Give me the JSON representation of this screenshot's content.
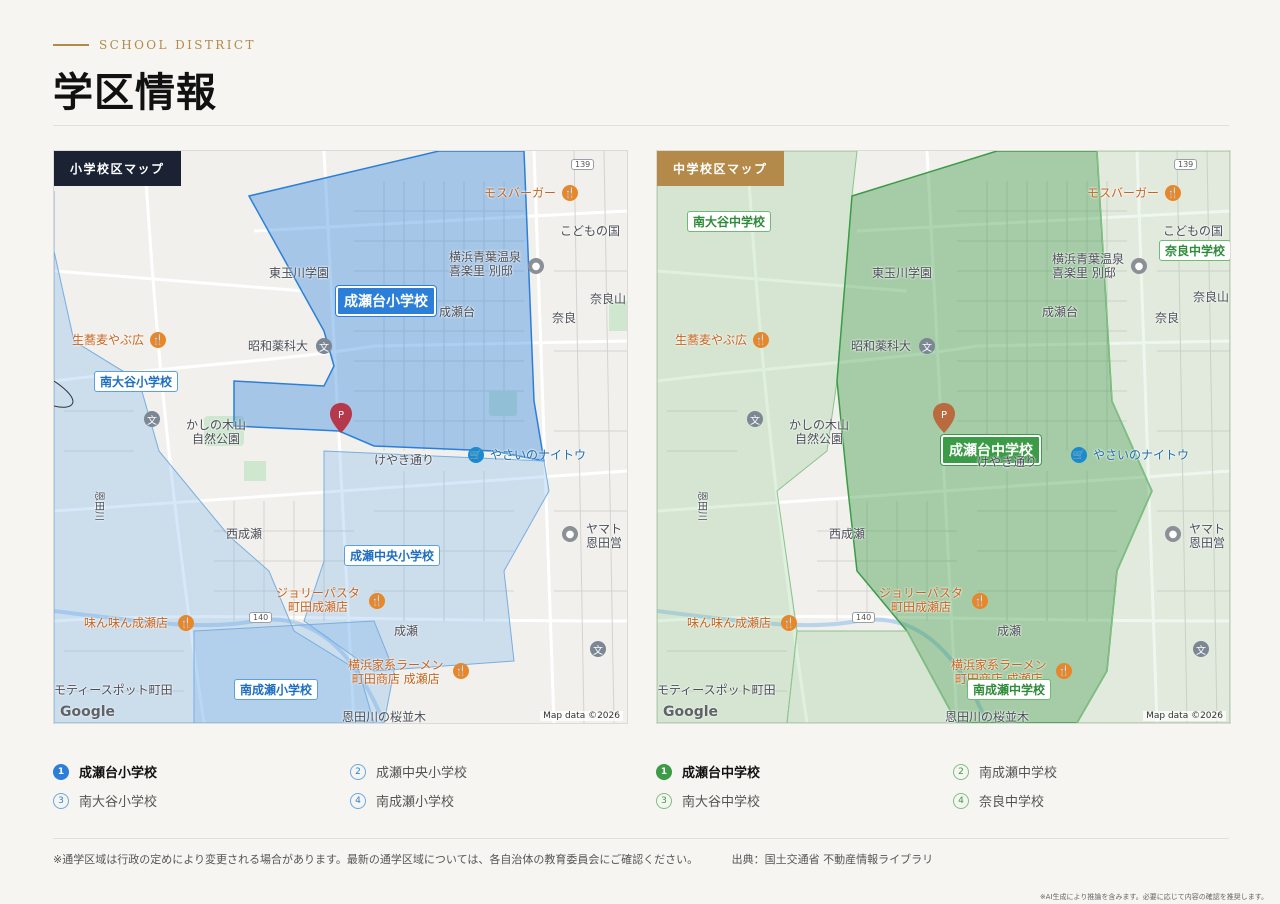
{
  "header": {
    "eyebrow": "SCHOOL DISTRICT",
    "title": "学区情報"
  },
  "maps": {
    "elementary": {
      "tag": "小学校区マップ",
      "labels": {
        "higashi_tamagawa": "東玉川学園",
        "showa_yakka": "昭和薬科大",
        "naruseidai": "成瀬台",
        "nara": "奈良",
        "kashi_park": "かしの木山\n自然公園",
        "keyaki": "けやき通り",
        "nishinaruse": "西成瀬",
        "naruse": "成瀬",
        "yokohama_aoba": "横浜青葉温泉\n喜楽里 別邸",
        "kodomo": "こどもの国",
        "narayama": "奈良山",
        "yamato": "ヤマト\n恩田営",
        "onda_river": "恩田川の桜並木",
        "motyspot": "モティースポット町田",
        "onda": "恩田川"
      },
      "pois": {
        "mos": "モスバーガー",
        "soba": "生蕎麦やぶ広",
        "jolly": "ジョリーパスタ\n町田成瀬店",
        "miun": "味ん味ん成瀬店",
        "ramen": "横浜家系ラーメン\n町田商店 成瀬店",
        "yasai": "やさいのナイトウ"
      },
      "schools": {
        "main": "成瀬台小学校",
        "minamioya": "南大谷小学校",
        "chuo": "成瀬中央小学校",
        "minaminaruse": "南成瀬小学校"
      },
      "roads": {
        "r139": "139",
        "r140": "140"
      },
      "google": "Google",
      "copyright": "Map data ©2026"
    },
    "middle": {
      "tag": "中学校区マップ",
      "labels": {
        "higashi_tamagawa": "東玉川学園",
        "showa_yakka": "昭和薬科大",
        "naruseidai": "成瀬台",
        "nara": "奈良",
        "kashi_park": "かしの木山\n自然公園",
        "keyaki": "けやき通り",
        "nishinaruse": "西成瀬",
        "naruse": "成瀬",
        "yokohama_aoba": "横浜青葉温泉\n喜楽里 別邸",
        "kodomo": "こどもの国",
        "narayama": "奈良山",
        "yamato": "ヤマト\n恩田営",
        "onda_river": "恩田川の桜並木",
        "motyspot": "モティースポット町田",
        "onda": "恩田川"
      },
      "pois": {
        "mos": "モスバーガー",
        "soba": "生蕎麦やぶ広",
        "jolly": "ジョリーパスタ\n町田成瀬店",
        "miun": "味ん味ん成瀬店",
        "ramen": "横浜家系ラーメン\n町田商店 成瀬店",
        "yasai": "やさいのナイトウ"
      },
      "schools": {
        "main": "成瀬台中学校",
        "minamioya": "南大谷中学校",
        "nara": "奈良中学校",
        "minaminaruse": "南成瀬中学校"
      },
      "roads": {
        "r139": "139",
        "r140": "140"
      },
      "google": "Google",
      "copyright": "Map data ©2026"
    }
  },
  "lists": {
    "elementary": [
      {
        "n": "1",
        "name": "成瀬台小学校"
      },
      {
        "n": "2",
        "name": "成瀬中央小学校"
      },
      {
        "n": "3",
        "name": "南大谷小学校"
      },
      {
        "n": "4",
        "name": "南成瀬小学校"
      }
    ],
    "middle": [
      {
        "n": "1",
        "name": "成瀬台中学校"
      },
      {
        "n": "2",
        "name": "南成瀬中学校"
      },
      {
        "n": "3",
        "name": "南大谷中学校"
      },
      {
        "n": "4",
        "name": "奈良中学校"
      }
    ]
  },
  "footer": {
    "note": "※通学区域は行政の定めにより変更される場合があります。最新の通学区域については、各自治体の教育委員会にご確認ください。",
    "source": "出典：国土交通省 不動産情報ライブラリ",
    "ai": "※AI生成により推論を含みます。必要に応じて内容の確認を推奨します。"
  },
  "colors": {
    "accent": "#b48a4a",
    "elementary": "#2b7fd8",
    "middle": "#3b9b46",
    "dark": "#1a2233"
  }
}
